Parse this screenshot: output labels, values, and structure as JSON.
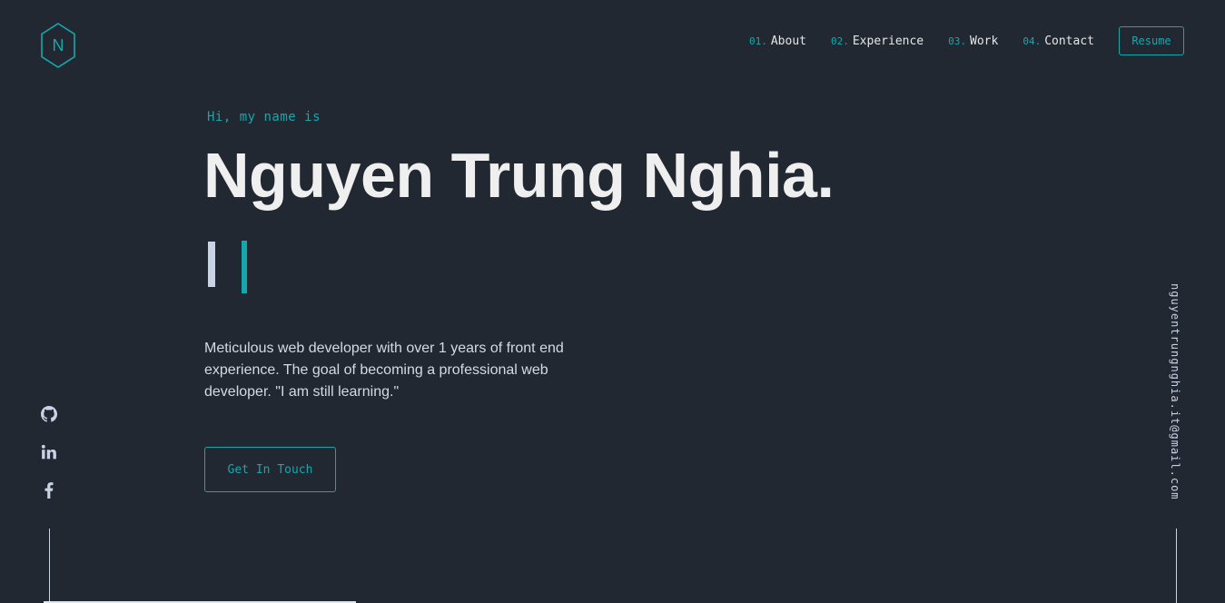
{
  "logo": {
    "letter": "N",
    "color": "#14a8ad"
  },
  "nav": {
    "items": [
      {
        "num": "01.",
        "label": "About"
      },
      {
        "num": "02.",
        "label": "Experience"
      },
      {
        "num": "03.",
        "label": "Work"
      },
      {
        "num": "04.",
        "label": "Contact"
      }
    ],
    "resume_label": "Resume"
  },
  "hero": {
    "greeting": "Hi, my name is",
    "name": "Nguyen Trung Nghia.",
    "typed_text": "|",
    "description": "Meticulous web developer with over 1 years of front end experience. The goal of becoming a professional web developer. \"I am still learning.\"",
    "cta_label": "Get In Touch"
  },
  "socials": [
    {
      "icon": "github-icon"
    },
    {
      "icon": "linkedin-icon"
    },
    {
      "icon": "facebook-icon"
    }
  ],
  "email": "nguyentrungnghia.it@gmail.com",
  "colors": {
    "background": "#222831",
    "accent": "#14a8ad",
    "text": "#e6e6e6",
    "muted": "#c8d3e6"
  }
}
